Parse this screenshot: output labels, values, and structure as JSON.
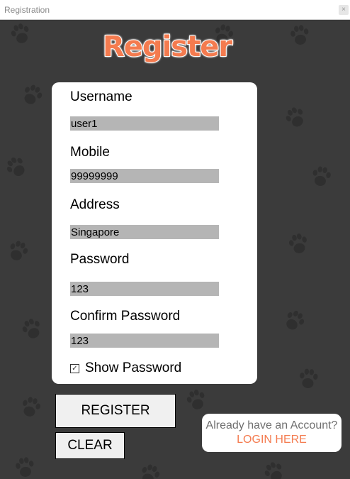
{
  "window": {
    "title": "Registration",
    "close_label": "×"
  },
  "heading": "Register",
  "form": {
    "username_label": "Username",
    "username_value": "user1",
    "mobile_label": "Mobile",
    "mobile_value": "99999999",
    "address_label": "Address",
    "address_value": "Singapore",
    "password_label": "Password",
    "password_value": "123",
    "confirm_label": "Confirm Password",
    "confirm_value": "123",
    "show_password_label": "Show Password",
    "show_password_checked": true
  },
  "buttons": {
    "register": "REGISTER",
    "clear": "CLEAR"
  },
  "login": {
    "question": "Already have an Account?",
    "link": "LOGIN HERE"
  },
  "colors": {
    "accent": "#f47b4f",
    "background": "#3b3b3b",
    "field": "#b5b5b5"
  }
}
